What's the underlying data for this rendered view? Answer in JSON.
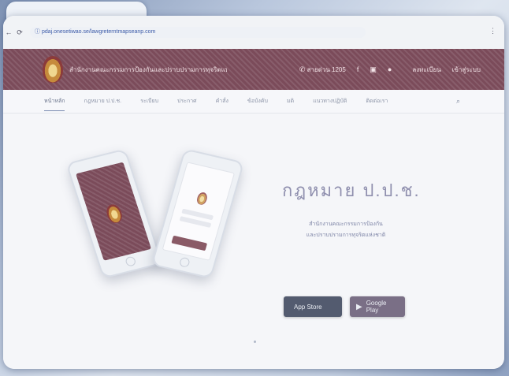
{
  "browser": {
    "back_icon": "arrow-left-icon",
    "reload_icon": "reload-icon",
    "url": "https://www.ratchakitcha.soc.go.th/DATA/PDF/2560/A/104/1.PDF",
    "url_display": "ⓘ pdaj.onesetiwao.se/lawgreterntmapseanp.com"
  },
  "header": {
    "site_name": "สำนักงานคณะกรรมการป้องกันและปราบปรามการทุจริตแห่งชาติ",
    "phone": "สายด่วน 1205",
    "phone_icon": "phone-icon",
    "facebook_icon": "facebook-icon",
    "youtube_icon": "youtube-icon",
    "user_icon": "user-icon",
    "register_label": "ลงทะเบียน",
    "login_label": "เข้าสู่ระบบ",
    "bg_color": "#7b4b5a"
  },
  "nav": {
    "items": [
      "หน้าหลัก",
      "กฎหมาย ป.ป.ช.",
      "ระเบียบ",
      "ประกาศ",
      "คำสั่ง",
      "ข้อบังคับ",
      "มติ",
      "แนวทางปฏิบัติ",
      "ติดต่อเรา"
    ],
    "search_icon": "search-icon"
  },
  "hero": {
    "title": "กฎหมาย ป.ป.ช.",
    "subtitle_line1": "สำนักงานคณะกรรมการป้องกัน",
    "subtitle_line2": "และปราบปรามการทุจริตแห่งชาติ",
    "app_store_label": "App Store",
    "google_play_label": "Google Play",
    "apple_icon": "apple-icon",
    "play_icon": "play-icon"
  }
}
